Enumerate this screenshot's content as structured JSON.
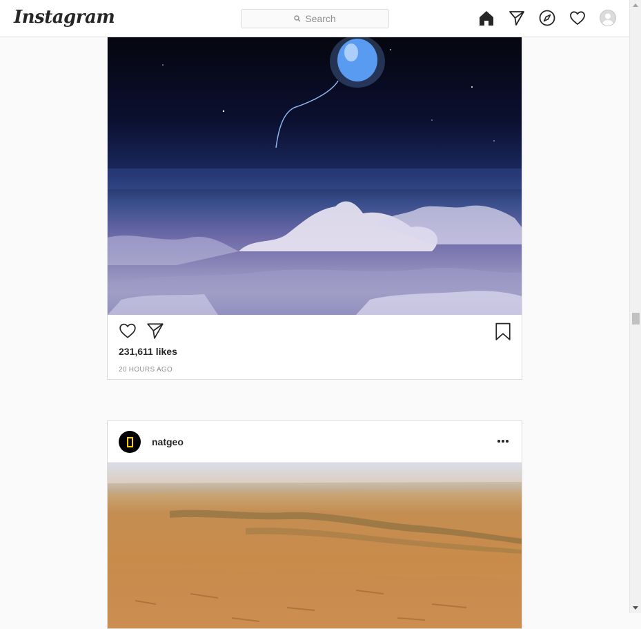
{
  "app": {
    "logo_text": "Instagram"
  },
  "search": {
    "placeholder": "Search"
  },
  "nav": [
    "home-icon",
    "direct-icon",
    "explore-icon",
    "activity-icon",
    "profile-avatar"
  ],
  "posts": [
    {
      "image": "balloon-over-clouds-photo",
      "likes": "231,611 likes",
      "time": "20 HOURS AGO"
    },
    {
      "username": "natgeo",
      "image": "desert-landscape-photo"
    }
  ],
  "colors": {
    "text": "#262626",
    "muted": "#8e8e8e",
    "border": "#dbdbdb",
    "background": "#fafafa",
    "natgeo_yellow": "#ffce00"
  }
}
